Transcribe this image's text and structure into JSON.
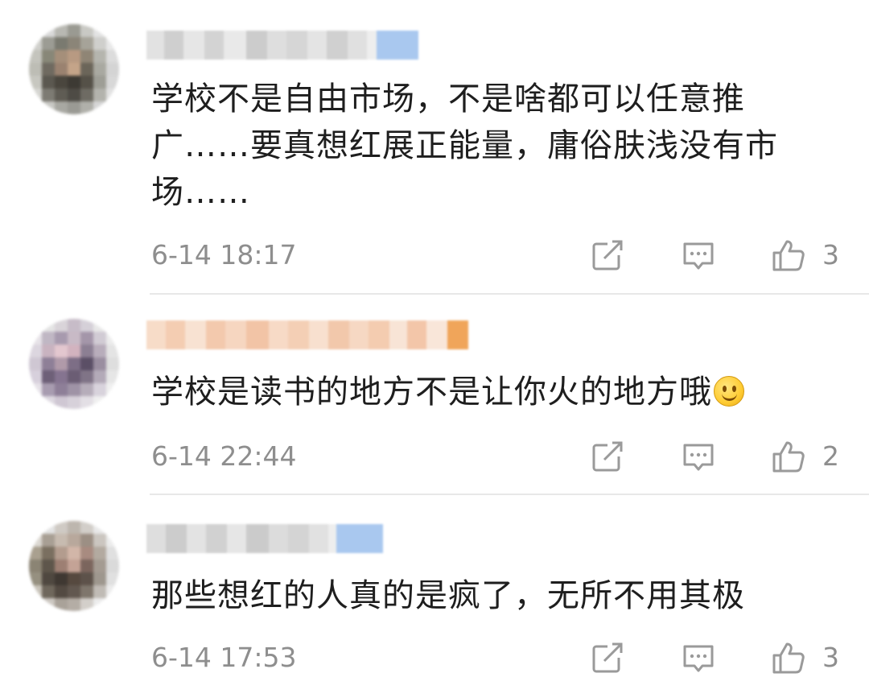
{
  "comments": [
    {
      "text_lines": [
        "学校不是自由市场，不是啥都可以任意推",
        "广……要真想红展正能量，庸俗肤浅没有市",
        "场……"
      ],
      "time": "6-14 18:17",
      "likes": "3"
    },
    {
      "text_lines": [
        "学校是读书的地方不是让你火的地方哦"
      ],
      "time": "6-14 22:44",
      "likes": "2",
      "emoji": "smiley-icon"
    },
    {
      "text_lines": [
        "那些想红的人真的是疯了，无所不用其极"
      ],
      "time": "6-14 17:53",
      "likes": "3"
    }
  ],
  "icons": {
    "repost": "repost-icon",
    "comment": "comment-icon",
    "like": "thumbs-up-icon"
  },
  "colors": {
    "text": "#1e1e1e",
    "meta": "#8e8e8e",
    "divider": "#e8e8e8",
    "icon": "#9a9a9a"
  }
}
